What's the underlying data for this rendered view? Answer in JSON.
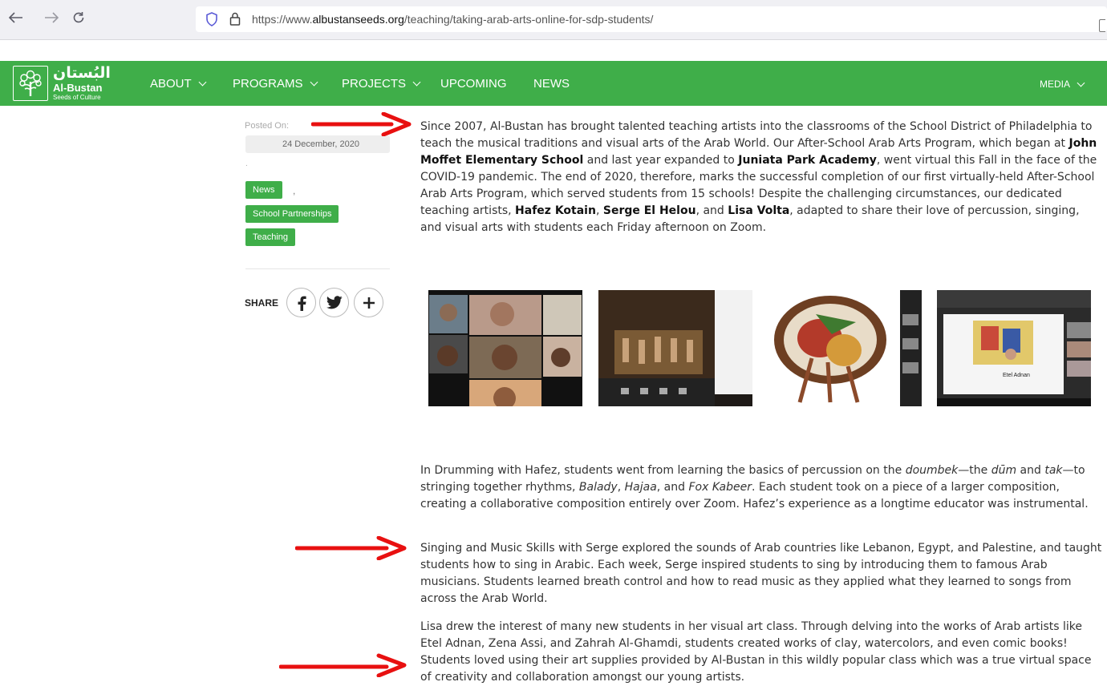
{
  "browser": {
    "url_prefix": "https://www.",
    "url_domain": "albustanseeds.org",
    "url_path": "/teaching/taking-arab-arts-online-for-sdp-students/"
  },
  "site": {
    "logo_arabic": "البُستان",
    "logo_name": "Al-Bustan",
    "logo_tagline": "Seeds of Culture",
    "brand_color": "#3fae49",
    "nav": {
      "about": "ABOUT",
      "programs": "PROGRAMS",
      "projects": "PROJECTS",
      "upcoming": "UPCOMING",
      "news": "NEWS",
      "media": "MEDIA"
    }
  },
  "sidebar": {
    "posted_label": "Posted On:",
    "date": "24 December, 2020",
    "dot": ".",
    "tags": [
      "News",
      "School Partnerships",
      "Teaching"
    ],
    "tag_separator": ",",
    "share_label": "SHARE"
  },
  "article": {
    "p1": {
      "a": "Since 2007, Al-Bustan has brought talented teaching artists into the classrooms of the School District of Philadelphia to teach the musical traditions and visual arts of the Arab World. Our After-School Arab Arts Program, which began at ",
      "b1": "John Moffet Elementary School",
      "c": " and last year expanded to ",
      "b2": "Juniata Park Academy",
      "d": ", went virtual this Fall in the face of the COVID-19 pandemic. The end of 2020, therefore, marks the successful completion of our first virtually-held After-School Arab Arts Program, which served students from 15 schools!  Despite the challenging circumstances, our dedicated teaching artists, ",
      "b3": "Hafez Kotain",
      "e": ", ",
      "b4": "Serge El Helou",
      "f": ", and ",
      "b5": "Lisa Volta",
      "g": ", adapted to share their love of percussion, singing, and visual arts with students each Friday afternoon on Zoom."
    },
    "p2": {
      "a": "In Drumming with Hafez, students went from learning the basics of percussion on the ",
      "i1": "doumbek",
      "b": "—the ",
      "i2": "dūm",
      "c": " and ",
      "i3": "tak",
      "d": "—to stringing together rhythms, ",
      "i4": "Balady",
      "e": ", ",
      "i5": "Hajaa",
      "f": ", and ",
      "i6": "Fox Kabeer",
      "g": ". Each student took on a piece of a larger composition, creating a collaborative composition entirely over Zoom. Hafez’s experience as a longtime educator was instrumental."
    },
    "p3": "Singing and Music Skills with Serge explored the sounds of Arab countries like Lebanon, Egypt, and Palestine, and taught students how to sing in Arabic. Each week, Serge inspired students to sing by introducing them to famous Arab musicians. Students learned breath control and how to read music as they applied what they learned to songs from across the Arab World.",
    "p4": "Lisa drew the interest of many new students in her visual art class. Through delving into the works of Arab artists like Etel Adnan, Zena Assi, and Zahrah Al-Ghamdi, students created works of clay, watercolors, and even comic books! Students loved using their art supplies provided by Al-Bustan in this wildly popular class which was a true virtual space of creativity and collaboration amongst our young artists.",
    "gallery_caption_4": "Etel Adnan"
  }
}
